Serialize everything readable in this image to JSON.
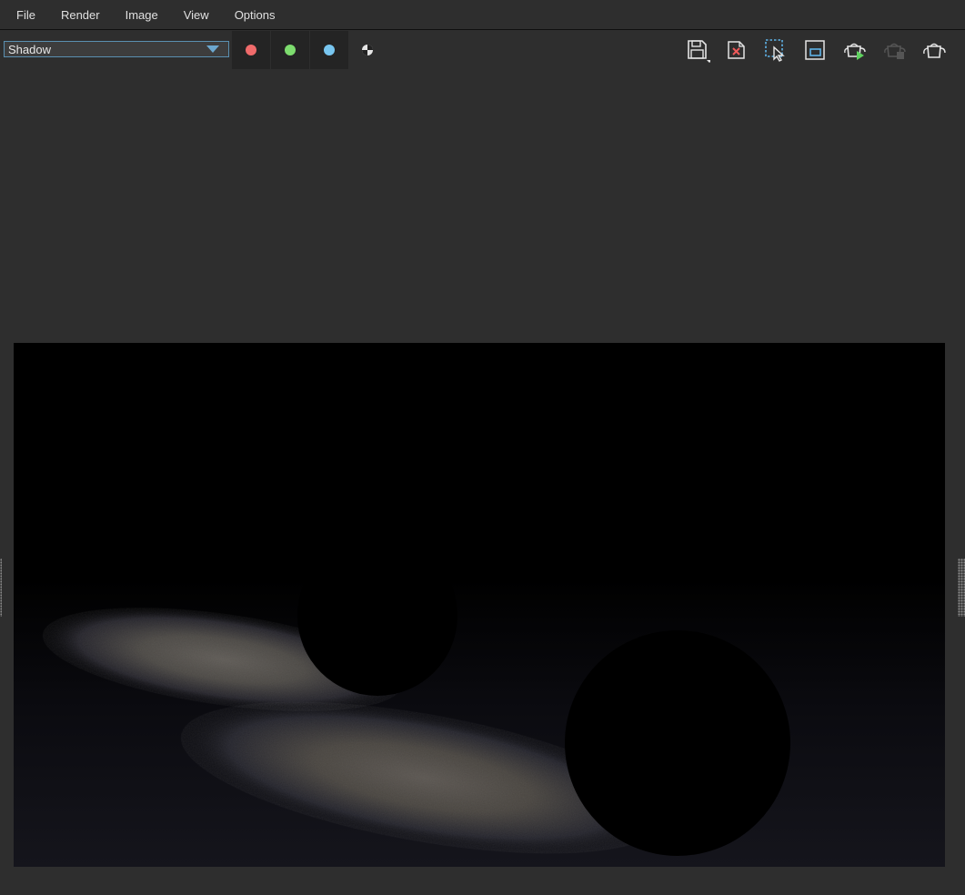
{
  "menu": {
    "items": [
      "File",
      "Render",
      "Image",
      "View",
      "Options"
    ]
  },
  "toolbar": {
    "channel_select": {
      "value": "Shadow",
      "accent": "#5a8fb0"
    },
    "channels": [
      {
        "name": "red",
        "color": "#f06b6b"
      },
      {
        "name": "green",
        "color": "#7ddc6e"
      },
      {
        "name": "blue",
        "color": "#78c6f0"
      }
    ],
    "alpha_icon": "alpha-channel-icon",
    "tools": [
      {
        "name": "save-image",
        "icon": "save-icon",
        "enabled": true
      },
      {
        "name": "clear-image",
        "icon": "clear-icon",
        "enabled": true
      },
      {
        "name": "select-region",
        "icon": "region-select-icon",
        "enabled": true
      },
      {
        "name": "crop-region",
        "icon": "crop-icon",
        "enabled": true
      },
      {
        "name": "render-active",
        "icon": "teapot-render-icon",
        "enabled": true
      },
      {
        "name": "stop-render",
        "icon": "teapot-stop-icon",
        "enabled": false
      },
      {
        "name": "render",
        "icon": "teapot-icon",
        "enabled": true
      }
    ]
  },
  "viewport": {
    "background": "#000000",
    "content": "shadow-pass-render"
  }
}
